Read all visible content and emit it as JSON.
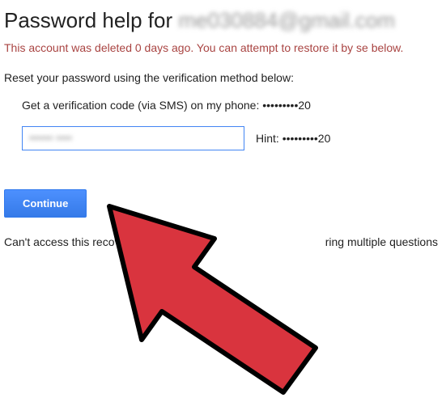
{
  "title": {
    "prefix": "Password help for",
    "email": "me030884@gmail.com"
  },
  "warning": "This account was deleted 0 days ago. You can attempt to restore it by se below.",
  "instruction": "Reset your password using the verification method below:",
  "verification": {
    "label_prefix": "Get a verification code (via SMS) on my phone: ",
    "masked_phone": "•••••••••20"
  },
  "hint": {
    "label": "Hint: ",
    "value": "•••••••••20"
  },
  "button": {
    "continue": "Continue"
  },
  "cant_access": {
    "left": "Can't access this recove",
    "right": "ring multiple questions"
  }
}
